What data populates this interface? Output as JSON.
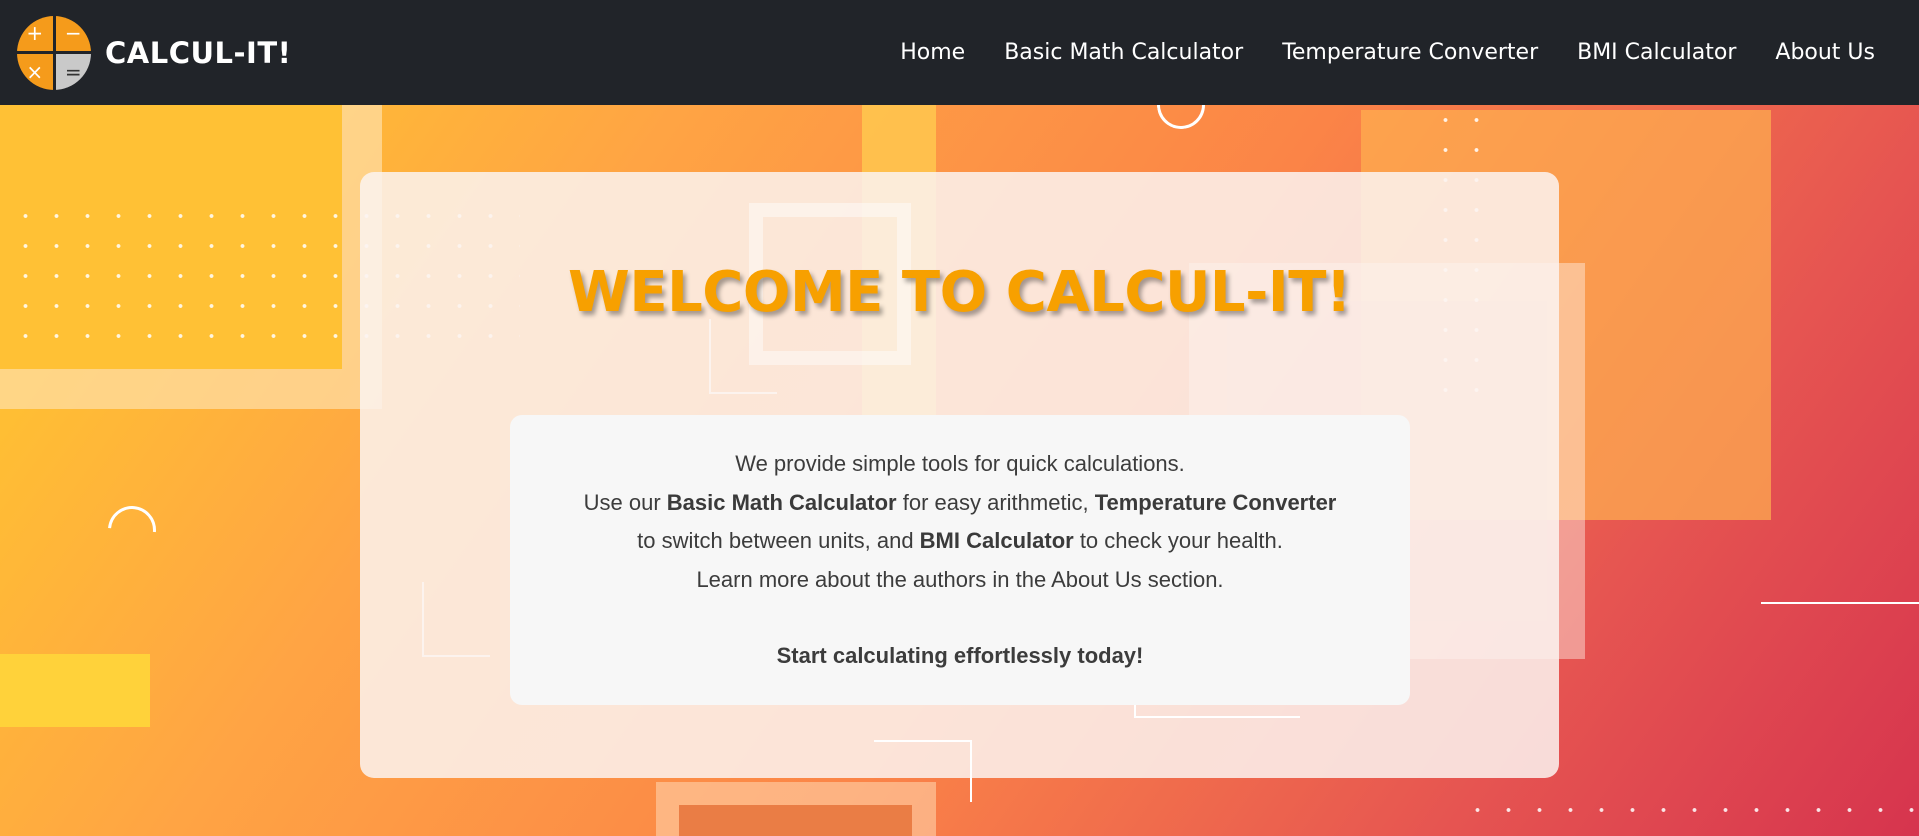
{
  "app": {
    "brand": "CALCUL-IT!",
    "logo_symbols": [
      "+",
      "−",
      "×",
      "="
    ]
  },
  "nav": {
    "items": [
      "Home",
      "Basic Math Calculator",
      "Temperature Converter",
      "BMI Calculator",
      "About Us"
    ]
  },
  "hero": {
    "title": "WELCOME TO CALCUL-IT!",
    "line1": "We provide simple tools for quick calculations.",
    "line2_a": "Use our ",
    "line2_b": "Basic Math Calculator",
    "line2_c": " for easy arithmetic, ",
    "line2_d": "Temperature Converter",
    "line3_a": "to switch between units, and ",
    "line3_b": "BMI Calculator",
    "line3_c": " to check your health.",
    "line4": "Learn more about the authors in the About Us section.",
    "cta": "Start calculating effortlessly today!"
  },
  "colors": {
    "navbar": "#212429",
    "accent": "#f7a000",
    "gradient_start": "#ffcb2c",
    "gradient_end": "#d6344e"
  }
}
